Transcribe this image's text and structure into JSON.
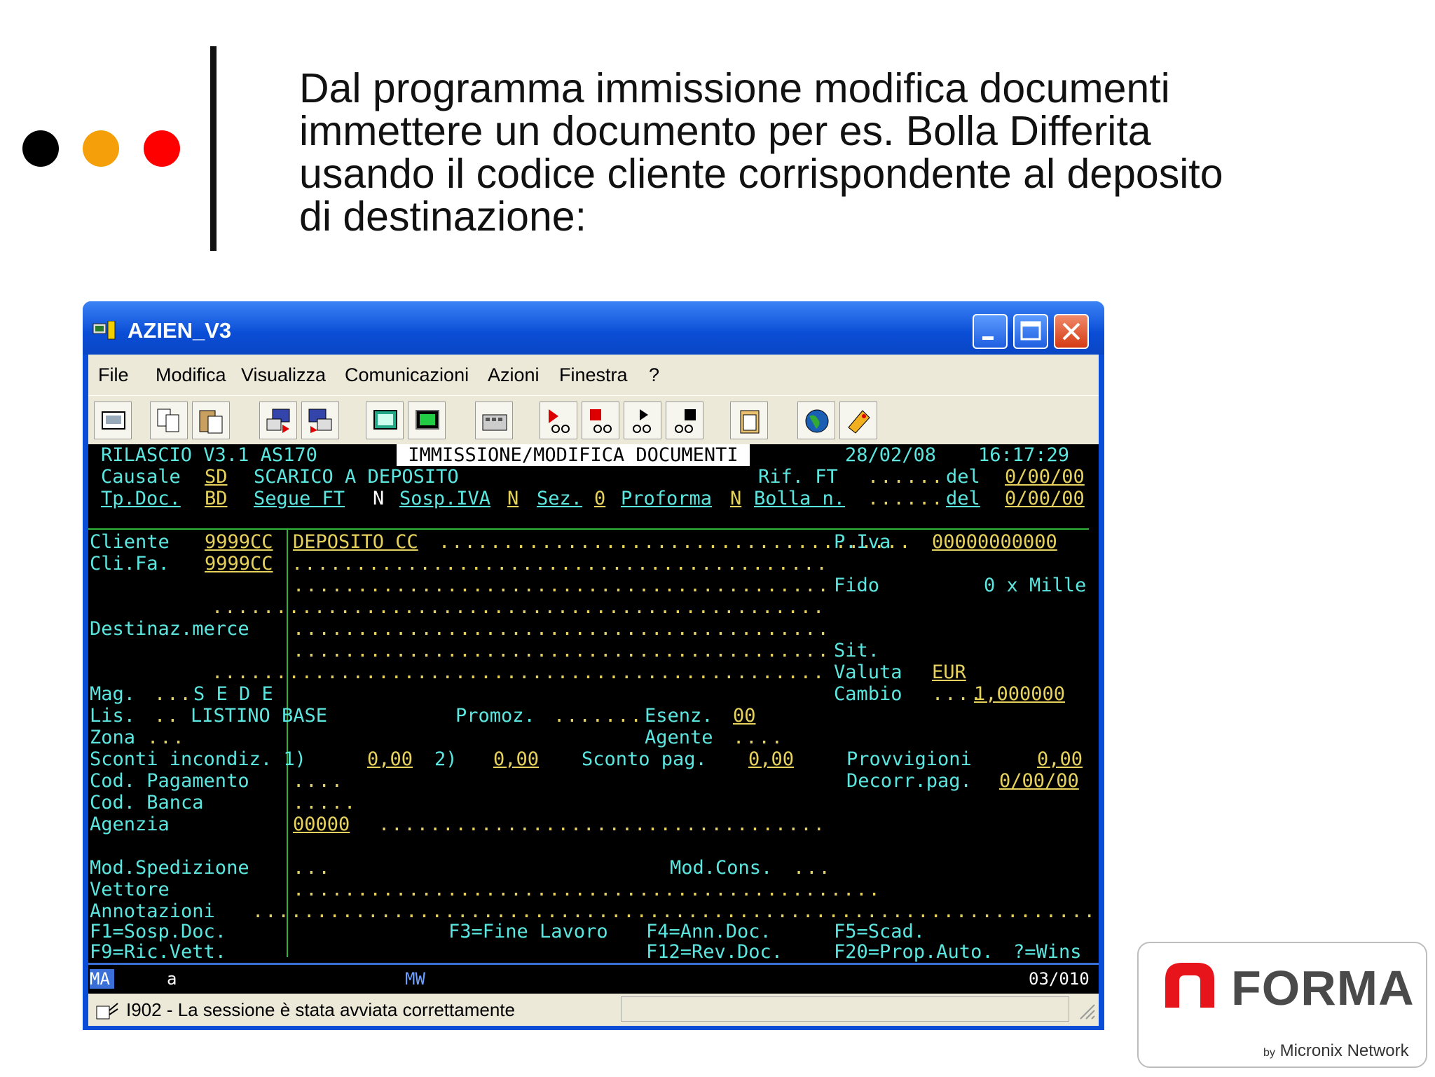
{
  "slide": {
    "heading_lines": [
      "Dal programma immissione modifica documenti",
      "immettere un documento per es. Bolla Differita",
      "usando il codice cliente corrispondente al deposito",
      "di destinazione:"
    ],
    "dot_colors": [
      "#000000",
      "#f5a00a",
      "#ff0000"
    ]
  },
  "window": {
    "title": "AZIEN_V3",
    "menu": [
      "File",
      "Modifica",
      "Visualizza",
      "Comunicazioni",
      "Azioni",
      "Finestra",
      "?"
    ]
  },
  "terminal": {
    "r1": {
      "left": "RILASCIO V3.1 AS170",
      "title": " IMMISSIONE/MODIFICA DOCUMENTI ",
      "date": "28/02/08",
      "time": "16:17:29"
    },
    "r2": {
      "label": "Causale",
      "code": "SD",
      "desc": "SCARICO A DEPOSITO",
      "rif": "Rif. FT",
      "del": "del",
      "date": "0/00/00"
    },
    "r3": {
      "label": "Tp.Doc.",
      "code": "BD",
      "segue": "Segue FT",
      "segue_v": "N",
      "sosp": "Sosp.IVA",
      "sosp_v": "N",
      "sez": "Sez.",
      "sez_v": "0",
      "proforma": "Proforma",
      "proforma_v": "N",
      "bolla": "Bolla n.",
      "del": "del",
      "date": "0/00/00"
    },
    "cliente": {
      "label": "Cliente",
      "code": "9999CC",
      "name": "DEPOSITO CC",
      "piva_label": "P.Iva",
      "piva": "00000000000"
    },
    "clifa": {
      "label": "Cli.Fa.",
      "code": "9999CC"
    },
    "fido": {
      "label": "Fido",
      "value": "0 x Mille"
    },
    "destinaz": {
      "label": "Destinaz.merce"
    },
    "sit": {
      "label": "Sit."
    },
    "valuta": {
      "label": "Valuta",
      "value": "EUR"
    },
    "cambio": {
      "label": "Cambio",
      "value": "1,000000"
    },
    "mag": {
      "label": "Mag.",
      "value": "S E D E"
    },
    "lis": {
      "label": "Lis.",
      "value": "LISTINO BASE",
      "promoz": "Promoz.",
      "esenz": "Esenz.",
      "esenz_v": "00"
    },
    "zona": {
      "label": "Zona",
      "agente": "Agente"
    },
    "sconti": {
      "label": "Sconti incondiz. 1)",
      "v1": "0,00",
      "l2": "2)",
      "v2": "0,00",
      "pag": "Sconto pag.",
      "pag_v": "0,00",
      "provv": "Provvigioni",
      "provv_v": "0,00"
    },
    "codpag": {
      "label": "Cod. Pagamento",
      "decorr": "Decorr.pag.",
      "decorr_v": "0/00/00"
    },
    "codbanca": {
      "label": "Cod. Banca"
    },
    "agenzia": {
      "label": "Agenzia",
      "value": "00000"
    },
    "modsped": {
      "label": "Mod.Spedizione",
      "modcons": "Mod.Cons."
    },
    "vettore": {
      "label": "Vettore"
    },
    "annot": {
      "label": "Annotazioni"
    },
    "keys1": {
      "f1": "F1=Sosp.Doc.",
      "f3": "F3=Fine Lavoro",
      "f4": "F4=Ann.Doc.",
      "f5": "F5=Scad."
    },
    "keys2": {
      "f9": "F9=Ric.Vett.",
      "f12": "F12=Rev.Doc.",
      "f20": "F20=Prop.Auto.",
      "wins": "?=Wins"
    }
  },
  "oia": {
    "ma": "MA",
    "a": "a",
    "mw": "MW",
    "pos": "03/010"
  },
  "status": {
    "message": "I902 - La sessione è stata avviata correttamente"
  },
  "logo": {
    "name": "FORMA",
    "by": "by",
    "network": "Micronix Network",
    "accent": "#e8141c"
  }
}
